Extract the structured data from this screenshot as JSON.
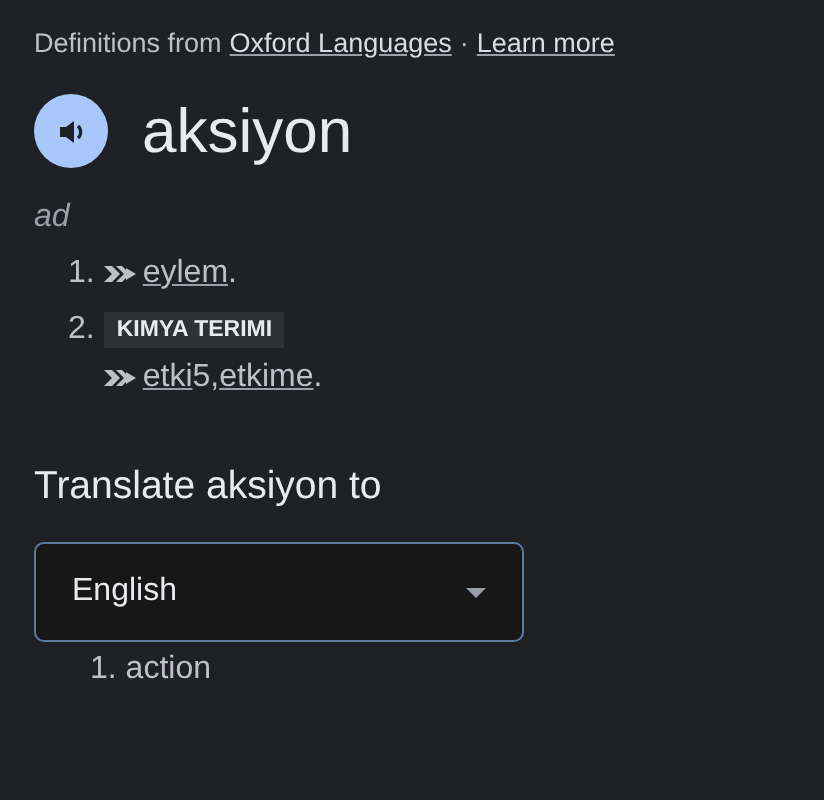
{
  "source": {
    "prefix": "Definitions from",
    "link": "Oxford Languages",
    "separator": "·",
    "learn_more": "Learn more"
  },
  "headword": "aksiyon",
  "part_of_speech": "ad",
  "senses": [
    {
      "number": "1.",
      "parts": [
        {
          "kind": "link",
          "text": "eylem"
        },
        {
          "kind": "text",
          "text": "."
        }
      ]
    },
    {
      "number": "2.",
      "label": "KIMYA TERIMI",
      "parts": [
        {
          "kind": "link",
          "text": "etki"
        },
        {
          "kind": "text",
          "text": "5,"
        },
        {
          "kind": "link",
          "text": "etkime"
        },
        {
          "kind": "text",
          "text": "."
        }
      ]
    }
  ],
  "translate": {
    "heading": "Translate aksiyon to",
    "language": "English",
    "results": [
      "1. action"
    ]
  }
}
